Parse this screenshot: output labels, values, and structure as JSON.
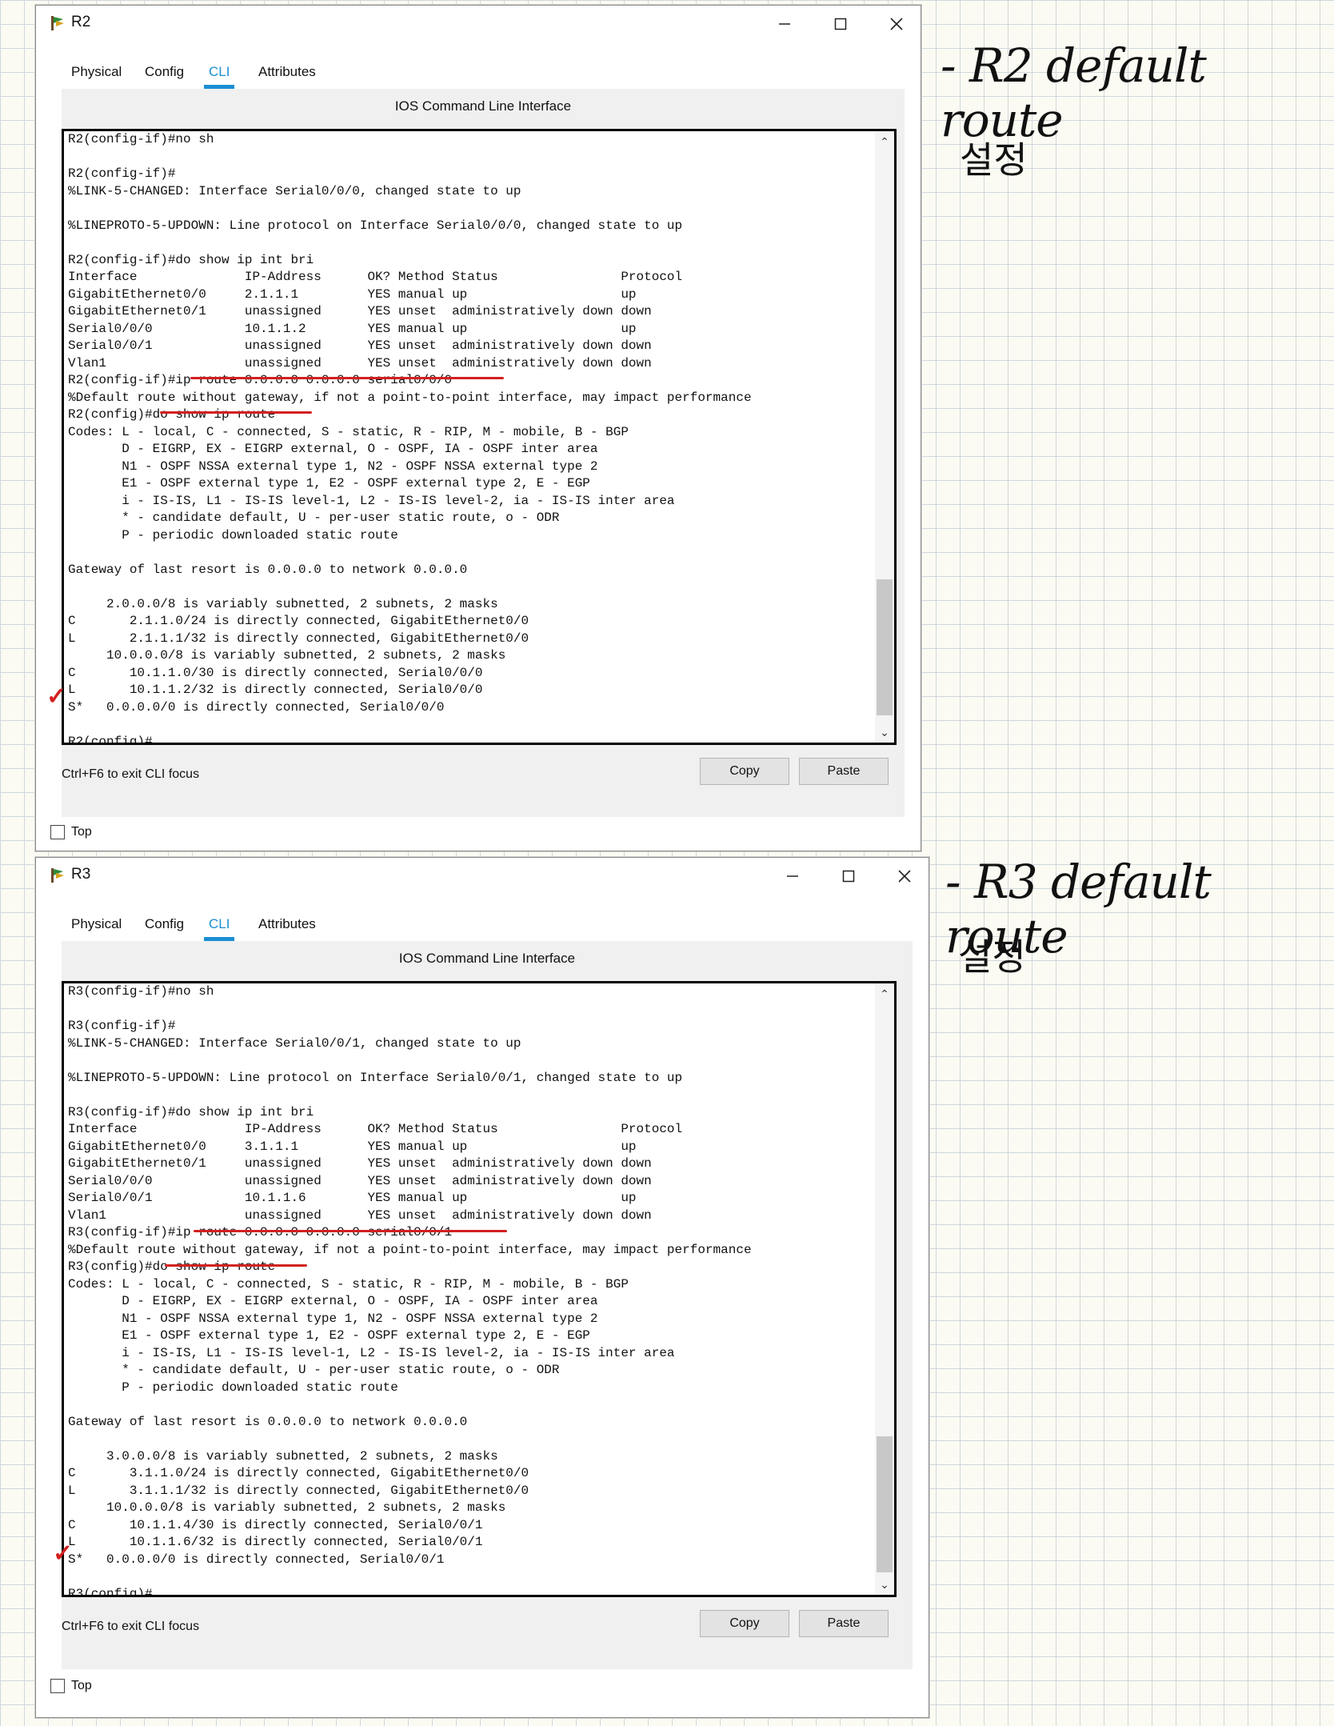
{
  "windows": [
    {
      "title": "R2",
      "tabs": [
        "Physical",
        "Config",
        "CLI",
        "Attributes"
      ],
      "active_tab": "CLI",
      "cli_caption": "IOS Command Line Interface",
      "terminal_text": "R2(config-if)#no sh\n\nR2(config-if)#\n%LINK-5-CHANGED: Interface Serial0/0/0, changed state to up\n\n%LINEPROTO-5-UPDOWN: Line protocol on Interface Serial0/0/0, changed state to up\n\nR2(config-if)#do show ip int bri\nInterface              IP-Address      OK? Method Status                Protocol\nGigabitEthernet0/0     2.1.1.1         YES manual up                    up\nGigabitEthernet0/1     unassigned      YES unset  administratively down down\nSerial0/0/0            10.1.1.2        YES manual up                    up\nSerial0/0/1            unassigned      YES unset  administratively down down\nVlan1                  unassigned      YES unset  administratively down down\nR2(config-if)#ip route 0.0.0.0 0.0.0.0 serial0/0/0\n%Default route without gateway, if not a point-to-point interface, may impact performance\nR2(config)#do show ip route\nCodes: L - local, C - connected, S - static, R - RIP, M - mobile, B - BGP\n       D - EIGRP, EX - EIGRP external, O - OSPF, IA - OSPF inter area\n       N1 - OSPF NSSA external type 1, N2 - OSPF NSSA external type 2\n       E1 - OSPF external type 1, E2 - OSPF external type 2, E - EGP\n       i - IS-IS, L1 - IS-IS level-1, L2 - IS-IS level-2, ia - IS-IS inter area\n       * - candidate default, U - per-user static route, o - ODR\n       P - periodic downloaded static route\n\nGateway of last resort is 0.0.0.0 to network 0.0.0.0\n\n     2.0.0.0/8 is variably subnetted, 2 subnets, 2 masks\nC       2.1.1.0/24 is directly connected, GigabitEthernet0/0\nL       2.1.1.1/32 is directly connected, GigabitEthernet0/0\n     10.0.0.0/8 is variably subnetted, 2 subnets, 2 masks\nC       10.1.1.0/30 is directly connected, Serial0/0/0\nL       10.1.1.2/32 is directly connected, Serial0/0/0\nS*   0.0.0.0/0 is directly connected, Serial0/0/0\n\nR2(config)#",
      "focus_hint": "Ctrl+F6 to exit CLI focus",
      "copy_label": "Copy",
      "paste_label": "Paste",
      "top_label": "Top"
    },
    {
      "title": "R3",
      "tabs": [
        "Physical",
        "Config",
        "CLI",
        "Attributes"
      ],
      "active_tab": "CLI",
      "cli_caption": "IOS Command Line Interface",
      "terminal_text": "R3(config-if)#no sh\n\nR3(config-if)#\n%LINK-5-CHANGED: Interface Serial0/0/1, changed state to up\n\n%LINEPROTO-5-UPDOWN: Line protocol on Interface Serial0/0/1, changed state to up\n\nR3(config-if)#do show ip int bri\nInterface              IP-Address      OK? Method Status                Protocol\nGigabitEthernet0/0     3.1.1.1         YES manual up                    up\nGigabitEthernet0/1     unassigned      YES unset  administratively down down\nSerial0/0/0            unassigned      YES unset  administratively down down\nSerial0/0/1            10.1.1.6        YES manual up                    up\nVlan1                  unassigned      YES unset  administratively down down\nR3(config-if)#ip route 0.0.0.0 0.0.0.0 serial0/0/1\n%Default route without gateway, if not a point-to-point interface, may impact performance\nR3(config)#do show ip route\nCodes: L - local, C - connected, S - static, R - RIP, M - mobile, B - BGP\n       D - EIGRP, EX - EIGRP external, O - OSPF, IA - OSPF inter area\n       N1 - OSPF NSSA external type 1, N2 - OSPF NSSA external type 2\n       E1 - OSPF external type 1, E2 - OSPF external type 2, E - EGP\n       i - IS-IS, L1 - IS-IS level-1, L2 - IS-IS level-2, ia - IS-IS inter area\n       * - candidate default, U - per-user static route, o - ODR\n       P - periodic downloaded static route\n\nGateway of last resort is 0.0.0.0 to network 0.0.0.0\n\n     3.0.0.0/8 is variably subnetted, 2 subnets, 2 masks\nC       3.1.1.0/24 is directly connected, GigabitEthernet0/0\nL       3.1.1.1/32 is directly connected, GigabitEthernet0/0\n     10.0.0.0/8 is variably subnetted, 2 subnets, 2 masks\nC       10.1.1.4/30 is directly connected, Serial0/0/1\nL       10.1.1.6/32 is directly connected, Serial0/0/1\nS*   0.0.0.0/0 is directly connected, Serial0/0/1\n\nR3(config)#",
      "focus_hint": "Ctrl+F6 to exit CLI focus",
      "copy_label": "Copy",
      "paste_label": "Paste",
      "top_label": "Top"
    }
  ],
  "notes": {
    "r2_title": "- R2 default route",
    "r2_sub": "설정",
    "r3_title": "- R3 default route",
    "r3_sub": "설정"
  },
  "colors": {
    "accent_tab": "#1a8fd3",
    "annotation": "#d32020"
  }
}
